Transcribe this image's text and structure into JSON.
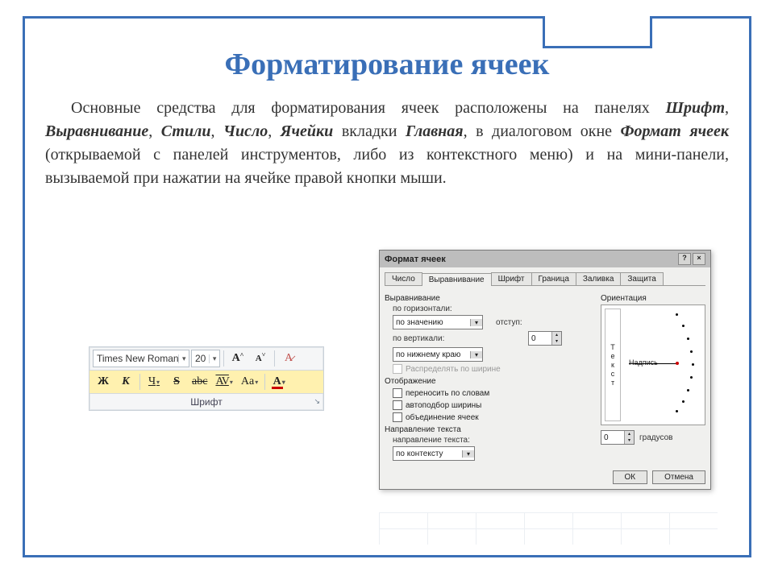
{
  "title": "Форматирование ячеек",
  "body": {
    "t1": "Основные средства для форматирования ячеек расположены на панелях ",
    "b1": "Шрифт",
    "c1": ", ",
    "b2": "Выравнивание",
    "c2": ", ",
    "b3": "Стили",
    "c3": ", ",
    "b4": "Число",
    "c4": ", ",
    "b5": "Ячейки",
    "t2": " вкладки ",
    "b6": "Главная",
    "t3": ", в диалоговом окне ",
    "b7": "Формат ячеек",
    "t4": " (открываемой с панелей инструментов, либо из контекстного меню) и на мини-панели, вызываемой при нажатии на ячейке правой кнопки мыши."
  },
  "ribbon": {
    "font_name": "Times New Roman",
    "font_size": "20",
    "grow_a": "A",
    "grow_sup": "˄",
    "shrink_a": "A",
    "shrink_sup": "˅",
    "clear_fmt": "A̷",
    "bold": "Ж",
    "italic": "К",
    "underline": "Ч",
    "strike_s": "S",
    "strike": "abc",
    "char_spacing": "AV",
    "case": "Aa",
    "fontcolor": "A",
    "group_label": "Шрифт",
    "launcher": "↘"
  },
  "dialog": {
    "title": "Формат ячеек",
    "tabs": [
      "Число",
      "Выравнивание",
      "Шрифт",
      "Граница",
      "Заливка",
      "Защита"
    ],
    "sections": {
      "align": "Выравнивание",
      "h_label": "по горизонтали:",
      "h_value": "по значению",
      "indent_label": "отступ:",
      "indent_value": "0",
      "v_label": "по вертикали:",
      "v_value": "по нижнему краю",
      "distribute": "Распределять по ширине",
      "display": "Отображение",
      "wrap": "переносить по словам",
      "autofit": "автоподбор ширины",
      "merge": "объединение ячеек",
      "direction": "Направление текста",
      "dir_label": "направление текста:",
      "dir_value": "по контексту",
      "orient": "Ориентация",
      "orient_vert_chars": [
        "Т",
        "е",
        "к",
        "с",
        "т"
      ],
      "needle_label": "Надпись",
      "deg_value": "0",
      "deg_label": "градусов"
    },
    "buttons": {
      "ok": "ОК",
      "cancel": "Отмена"
    },
    "win": {
      "help": "?",
      "close": "×"
    }
  }
}
